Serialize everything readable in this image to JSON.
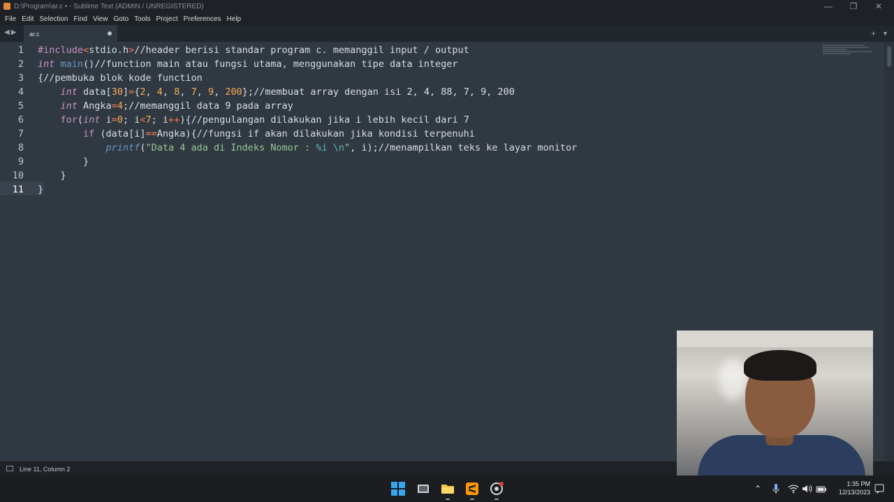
{
  "window": {
    "title": "D:\\Program\\ar.c • - Sublime Text (ADMIN / UNREGISTERED)",
    "minimize_glyph": "—",
    "maximize_glyph": "❐",
    "close_glyph": "✕"
  },
  "menu": [
    "File",
    "Edit",
    "Selection",
    "Find",
    "View",
    "Goto",
    "Tools",
    "Project",
    "Preferences",
    "Help"
  ],
  "tabs": {
    "nav_glyph": "◀▶",
    "active_label": "ar.c",
    "add_glyph": "+",
    "dropdown_glyph": "▼"
  },
  "editor": {
    "line_numbers": [
      "1",
      "2",
      "3",
      "4",
      "5",
      "6",
      "7",
      "8",
      "9",
      "10",
      "11"
    ],
    "current_line": 11,
    "lines": [
      [
        [
          "pp",
          "#include"
        ],
        [
          "op",
          "<"
        ],
        [
          "txt",
          "stdio.h"
        ],
        [
          "op",
          ">"
        ],
        [
          "cm",
          "//header berisi standar program c. memanggil input / output"
        ]
      ],
      [
        [
          "ty",
          "int"
        ],
        [
          "txt",
          " "
        ],
        [
          "fn",
          "main"
        ],
        [
          "txt",
          "()"
        ],
        [
          "cm",
          "//function main atau fungsi utama, menggunakan tipe data integer"
        ]
      ],
      [
        [
          "txt",
          "{"
        ],
        [
          "cm",
          "//pembuka blok kode function"
        ]
      ],
      [
        [
          "txt",
          "    "
        ],
        [
          "ty",
          "int"
        ],
        [
          "txt",
          " data["
        ],
        [
          "num",
          "30"
        ],
        [
          "txt",
          "]"
        ],
        [
          "op",
          "="
        ],
        [
          "txt",
          "{"
        ],
        [
          "num",
          "2"
        ],
        [
          "txt",
          ", "
        ],
        [
          "num",
          "4"
        ],
        [
          "txt",
          ", "
        ],
        [
          "num",
          "8"
        ],
        [
          "txt",
          ", "
        ],
        [
          "num",
          "7"
        ],
        [
          "txt",
          ", "
        ],
        [
          "num",
          "9"
        ],
        [
          "txt",
          ", "
        ],
        [
          "num",
          "200"
        ],
        [
          "txt",
          "};"
        ],
        [
          "cm",
          "//membuat array dengan isi 2, 4, 88, 7, 9, 200"
        ]
      ],
      [
        [
          "txt",
          "    "
        ],
        [
          "ty",
          "int"
        ],
        [
          "txt",
          " Angka"
        ],
        [
          "op",
          "="
        ],
        [
          "num",
          "4"
        ],
        [
          "txt",
          ";"
        ],
        [
          "cm",
          "//memanggil data 9 pada array"
        ]
      ],
      [
        [
          "txt",
          "    "
        ],
        [
          "kw",
          "for"
        ],
        [
          "txt",
          "("
        ],
        [
          "ty",
          "int"
        ],
        [
          "txt",
          " i"
        ],
        [
          "op",
          "="
        ],
        [
          "num",
          "0"
        ],
        [
          "txt",
          "; i"
        ],
        [
          "op",
          "<"
        ],
        [
          "num",
          "7"
        ],
        [
          "txt",
          "; i"
        ],
        [
          "op",
          "++"
        ],
        [
          "txt",
          "){"
        ],
        [
          "cm",
          "//pengulangan dilakukan jika i lebih kecil dari 7"
        ]
      ],
      [
        [
          "txt",
          "        "
        ],
        [
          "kw",
          "if"
        ],
        [
          "txt",
          " (data[i]"
        ],
        [
          "op",
          "=="
        ],
        [
          "txt",
          "Angka){"
        ],
        [
          "cm",
          "//fungsi if akan dilakukan jika kondisi terpenuhi"
        ]
      ],
      [
        [
          "txt",
          "            "
        ],
        [
          "fnit",
          "printf"
        ],
        [
          "txt",
          "("
        ],
        [
          "str",
          "\"Data 4 ada di Indeks Nomor : "
        ],
        [
          "esc",
          "%i"
        ],
        [
          "str",
          " "
        ],
        [
          "esc",
          "\\n"
        ],
        [
          "str",
          "\""
        ],
        [
          "txt",
          ", i);"
        ],
        [
          "cm",
          "//menampilkan teks ke layar monitor"
        ]
      ],
      [
        [
          "txt",
          "        }"
        ]
      ],
      [
        [
          "txt",
          "    }"
        ]
      ],
      [
        [
          "txt",
          "}"
        ]
      ]
    ]
  },
  "status": {
    "position": "Line 11, Column 2"
  },
  "taskbar": {
    "apps": [
      "start-icon",
      "task-view-icon",
      "file-explorer-icon",
      "sublime-text-icon",
      "chrome-icon"
    ],
    "tray_chevron": "⌃",
    "time": "1:35 PM",
    "date": "12/13/2023"
  },
  "colors": {
    "editor_bg": "#303841",
    "keyword": "#c695c6",
    "function": "#6699cc",
    "number": "#f9ae58",
    "operator": "#f97b58",
    "string": "#99c794"
  }
}
